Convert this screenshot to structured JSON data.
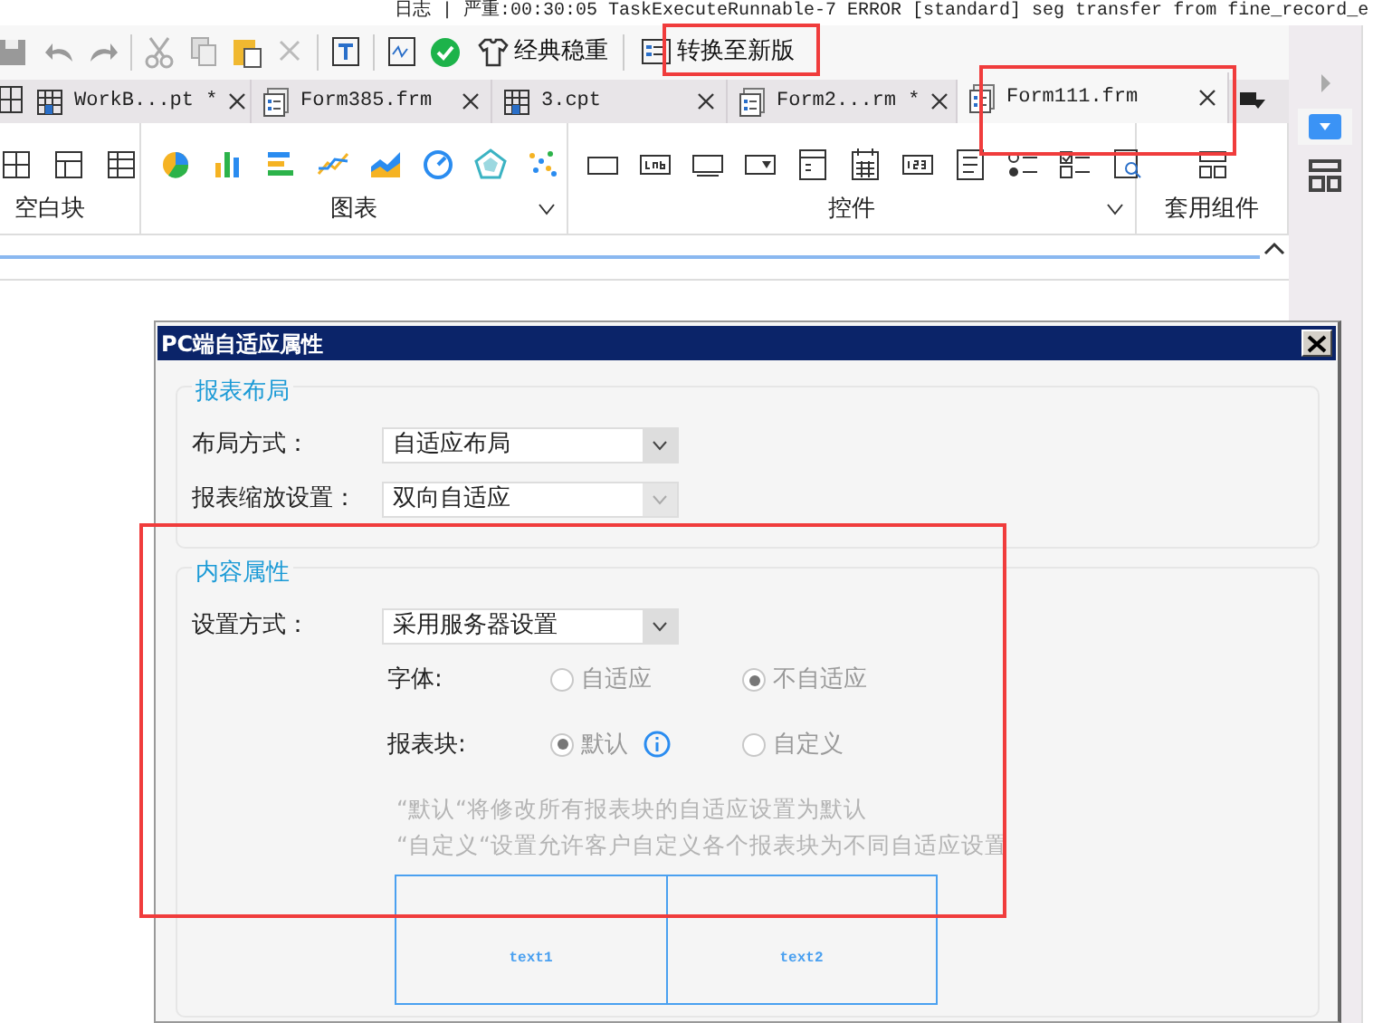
{
  "log_line": "日志 | 严重:00:30:05 TaskExecuteRunnable-7 ERROR [standard] seg transfer from fine_record_e",
  "toolbar": {
    "buttons": [
      {
        "label": "经典稳重",
        "kind": "shirt"
      },
      {
        "label": "转换至新版",
        "kind": "form"
      }
    ]
  },
  "tabs": [
    {
      "label": "WorkB...pt *",
      "kind": "cpt",
      "selected": false
    },
    {
      "label": "Form385.frm",
      "kind": "frm",
      "selected": false
    },
    {
      "label": "3.cpt",
      "kind": "cpt",
      "selected": false
    },
    {
      "label": "Form2...rm *",
      "kind": "frm",
      "selected": false
    },
    {
      "label": "Form111.frm",
      "kind": "frm",
      "selected": true
    }
  ],
  "ribbon": {
    "groups": [
      {
        "label": "空白块",
        "expandable": false
      },
      {
        "label": "图表",
        "expandable": true
      },
      {
        "label": "控件",
        "expandable": true
      },
      {
        "label": "套用组件",
        "expandable": false
      }
    ]
  },
  "dialog": {
    "title": "PC端自适应属性",
    "sections": [
      {
        "legend": "报表布局",
        "rows": [
          {
            "kind": "select",
            "label": "布局方式：",
            "value": "自适应布局",
            "disabled": false
          },
          {
            "kind": "select",
            "label": "报表缩放设置：",
            "value": "双向自适应",
            "disabled": true
          }
        ]
      },
      {
        "legend": "内容属性",
        "rows": [
          {
            "kind": "select",
            "label": "设置方式：",
            "value": "采用服务器设置",
            "disabled": false
          },
          {
            "kind": "radio",
            "label": "字体:",
            "disabled": true,
            "options": [
              {
                "label": "自适应",
                "selected": false,
                "info": false
              },
              {
                "label": "不自适应",
                "selected": true,
                "info": false
              }
            ]
          },
          {
            "kind": "radio",
            "label": "报表块:",
            "disabled": true,
            "options": [
              {
                "label": "默认",
                "selected": true,
                "info": true
              },
              {
                "label": "自定义",
                "selected": false,
                "info": false
              }
            ]
          },
          {
            "kind": "note",
            "lines": [
              "“默认“将修改所有报表块的自适应设置为默认",
              "“自定义“设置允许客户自定义各个报表块为不同自适应设置"
            ]
          },
          {
            "kind": "preview",
            "cells": [
              "text1",
              "text2"
            ]
          }
        ]
      }
    ]
  }
}
